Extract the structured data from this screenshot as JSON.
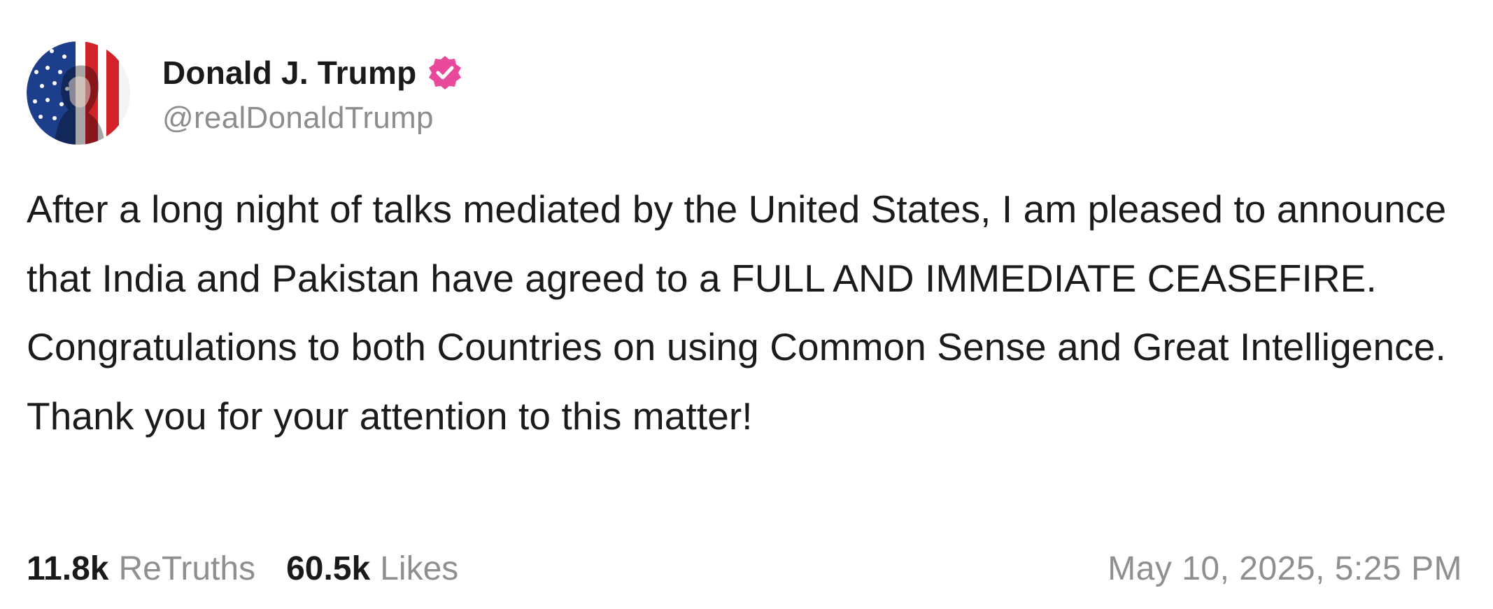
{
  "author": {
    "display_name": "Donald J. Trump",
    "handle": "@realDonaldTrump",
    "verified": true,
    "avatar_icon": "flag-portrait-avatar",
    "verified_badge_color": "#e8499a"
  },
  "post": {
    "text": "After a long night of talks mediated by the United States, I am pleased to announce that India and Pakistan have agreed to a FULL AND IMMEDIATE CEASEFIRE. Congratulations to both Countries on using Common Sense and Great Intelligence. Thank you for your attention to this matter!"
  },
  "stats": {
    "retruths_count": "11.8k",
    "retruths_label": "ReTruths",
    "likes_count": "60.5k",
    "likes_label": "Likes"
  },
  "timestamp": "May 10, 2025, 5:25 PM",
  "colors": {
    "text_primary": "#1a1a1a",
    "text_secondary": "#8f8f8f",
    "background": "#ffffff"
  }
}
